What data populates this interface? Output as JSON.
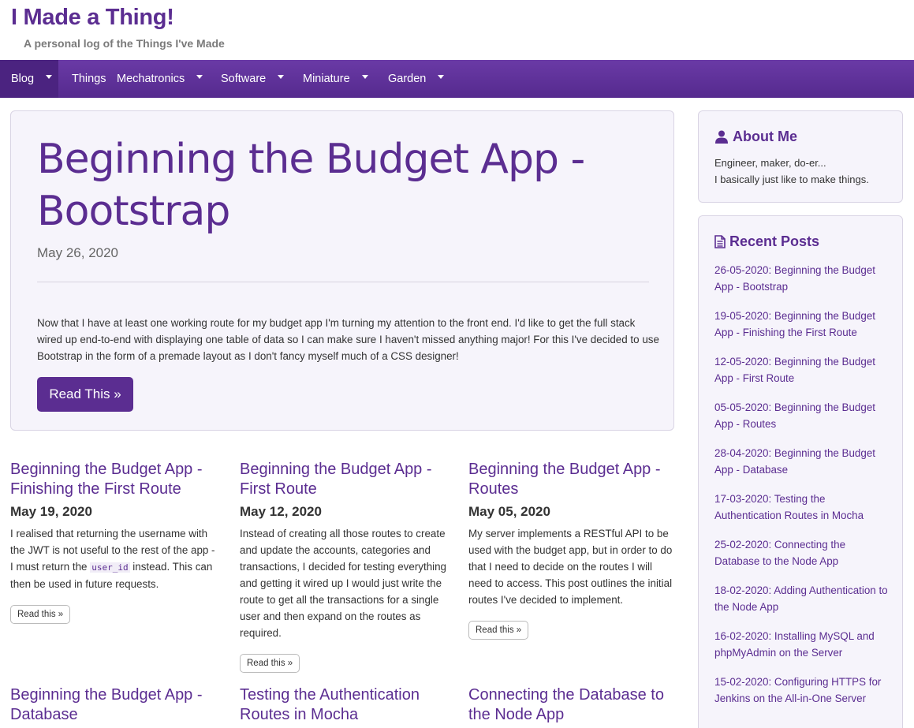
{
  "site": {
    "title": "I Made a Thing!",
    "tagline": "A personal log of the Things I've Made"
  },
  "nav": {
    "items": [
      {
        "label": "Blog",
        "dropdown": true,
        "active": true
      },
      {
        "label": "Things",
        "dropdown": false
      },
      {
        "label": "Mechatronics",
        "dropdown": true
      },
      {
        "label": "Software",
        "dropdown": true
      },
      {
        "label": "Miniature",
        "dropdown": true
      },
      {
        "label": "Garden",
        "dropdown": true
      }
    ]
  },
  "hero": {
    "title": "Beginning the Budget App - Bootstrap",
    "date": "May 26, 2020",
    "text": "Now that I have at least one working route for my budget app I'm turning my attention to the front end. I'd like to get the full stack wired up end-to-end with displaying one table of data so I can make sure I haven't missed anything major! For this I've decided to use Bootstrap in the form of a premade layout as I don't fancy myself much of a CSS designer!",
    "button": "Read This »"
  },
  "posts": [
    {
      "title": "Beginning the Budget App - Finishing the First Route",
      "date": "May 19, 2020",
      "text_before": "I realised that returning the username with the JWT is not useful to the rest of the app - I must return the ",
      "code": "user_id",
      "text_after": " instead. This can then be used in future requests.",
      "button": "Read this »"
    },
    {
      "title": "Beginning the Budget App - First Route",
      "date": "May 12, 2020",
      "text_before": "Instead of creating all those routes to create and update the accounts, categories and transactions, I decided for testing everything and getting it wired up I would just write the route to get all the transactions for a single user and then expand on the routes as required.",
      "code": "",
      "text_after": "",
      "button": "Read this »"
    },
    {
      "title": "Beginning the Budget App - Routes",
      "date": "May 05, 2020",
      "text_before": "My server implements a RESTful API to be used with the budget app, but in order to do that I need to decide on the routes I will need to access. This post outlines the initial routes I've decided to implement.",
      "code": "",
      "text_after": "",
      "button": "Read this »"
    },
    {
      "title": "Beginning the Budget App - Database"
    },
    {
      "title": "Testing the Authentication Routes in Mocha"
    },
    {
      "title": "Connecting the Database to the Node App"
    }
  ],
  "sidebar": {
    "about": {
      "heading": "About Me",
      "line1": "Engineer, maker, do-er...",
      "line2": "I basically just like to make things."
    },
    "recent": {
      "heading": "Recent Posts",
      "items": [
        "26-05-2020: Beginning the Budget App - Bootstrap",
        "19-05-2020: Beginning the Budget App - Finishing the First Route",
        "12-05-2020: Beginning the Budget App - First Route",
        "05-05-2020: Beginning the Budget App - Routes",
        "28-04-2020: Beginning the Budget App - Database",
        "17-03-2020: Testing the Authentication Routes in Mocha",
        "25-02-2020: Connecting the Database to the Node App",
        "18-02-2020: Adding Authentication to the Node App",
        "16-02-2020: Installing MySQL and phpMyAdmin on the Server",
        "15-02-2020: Configuring HTTPS for Jenkins on the All-in-One Server"
      ]
    }
  },
  "colors": {
    "brand": "#5b2d91",
    "nav_bg": "#6a3aa6",
    "nav_active": "#4b2380",
    "panel_bg": "#f6f4fb"
  }
}
